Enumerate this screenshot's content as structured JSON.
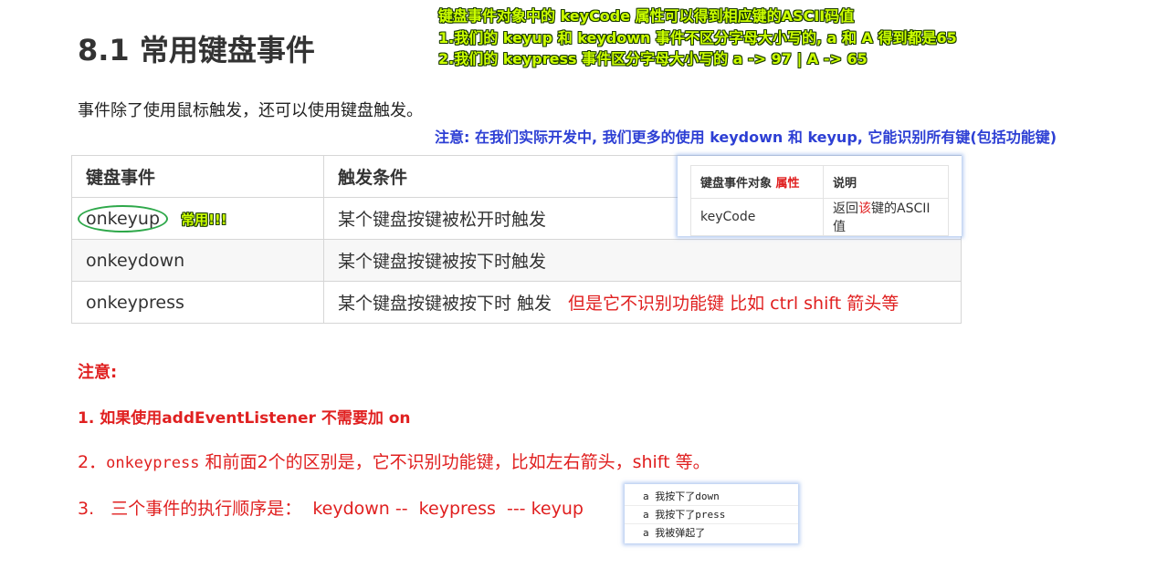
{
  "title": "8.1 常用键盘事件",
  "annotations": {
    "green_line1": "键盘事件对象中的 keyCode 属性可以得到相应键的ASCII码值",
    "green_line2": "1.我们的 keyup 和 keydown 事件不区分字母大小写的, a 和 A 得到都是65",
    "green_line3": "2.我们的 keypress 事件区分字母大小写的 a -> 97 | A -> 65",
    "blue_note": "注意: 在我们实际开发中, 我们更多的使用 keydown 和 keyup, 它能识别所有键(包括功能键)",
    "common_tag": "常用!!!"
  },
  "intro": "事件除了使用鼠标触发，还可以使用键盘触发。",
  "events_table": {
    "headers": [
      "键盘事件",
      "触发条件"
    ],
    "rows": [
      {
        "event": "onkeyup",
        "condition": "某个键盘按键被松开时触发",
        "extra": ""
      },
      {
        "event": "onkeydown",
        "condition": "某个键盘按键被按下时触发",
        "extra": ""
      },
      {
        "event": "onkeypress",
        "condition": "某个键盘按键被按下时 触发",
        "extra": "但是它不识别功能键 比如  ctrl shift 箭头等"
      }
    ]
  },
  "keycode_popup": {
    "header_col1_prefix": "键盘事件对象 ",
    "header_col1_highlight": "属性",
    "header_col2": "说明",
    "row_col1": "keyCode",
    "row_col2_prefix": "返回",
    "row_col2_highlight": "该",
    "row_col2_suffix": "键的ASCII 值"
  },
  "notes": {
    "title": "注意:",
    "item1": "1.  如果使用addEventListener 不需要加 on",
    "item2_prefix": "2．",
    "item2_code": "onkeypress",
    "item2_suffix": " 和前面2个的区别是，它不识别功能键，比如左右箭头，shift 等。",
    "item3": "3.   三个事件的执行顺序是：  keydown --  keypress  --- keyup"
  },
  "console_popup": {
    "lines": [
      "a 我按下了down",
      "a 我按下了press",
      "a 我被弹起了"
    ]
  },
  "colors": {
    "accent_red": "#e02020",
    "annotation_green": "#ccff00",
    "annotation_blue": "#2d3fd4",
    "circle_green": "#2ea84a"
  }
}
